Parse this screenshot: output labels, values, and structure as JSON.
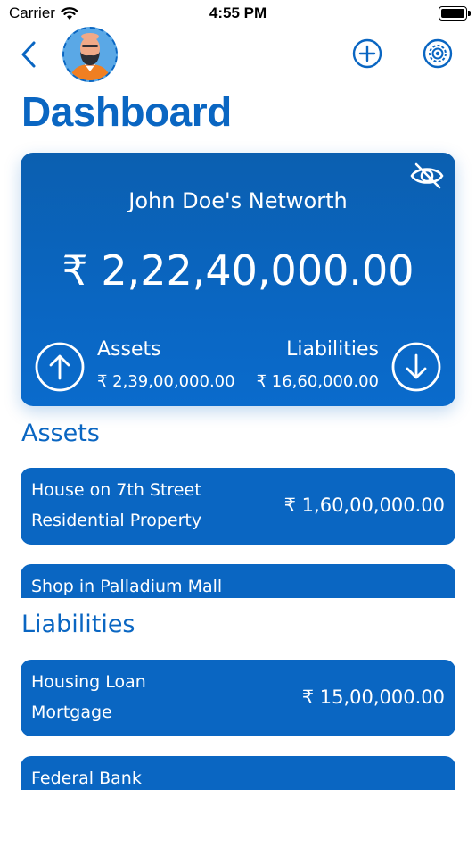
{
  "status_bar": {
    "carrier": "Carrier",
    "time": "4:55 PM"
  },
  "nav": {
    "back_icon": "chevron-left-icon",
    "add_icon": "plus-circle-icon",
    "settings_icon": "gear-circle-icon"
  },
  "page_title": "Dashboard",
  "networth": {
    "title": "John Doe's Networth",
    "value": "₹ 2,22,40,000.00",
    "assets_label": "Assets",
    "assets_value": "₹ 2,39,00,000.00",
    "liabilities_label": "Liabilities",
    "liabilities_value": "₹ 16,60,000.00"
  },
  "assets": {
    "heading": "Assets",
    "items": [
      {
        "name": "House on 7th Street",
        "type": "Residential Property",
        "value": "₹ 1,60,00,000.00"
      },
      {
        "name": "Shop in Palladium Mall",
        "type": "",
        "value": ""
      }
    ]
  },
  "liabilities": {
    "heading": "Liabilities",
    "items": [
      {
        "name": "Housing Loan",
        "type": "Mortgage",
        "value": "₹ 15,00,000.00"
      },
      {
        "name": "Federal Bank",
        "type": "",
        "value": ""
      }
    ]
  },
  "colors": {
    "accent": "#0a66c2",
    "card_text": "#ffffff"
  }
}
